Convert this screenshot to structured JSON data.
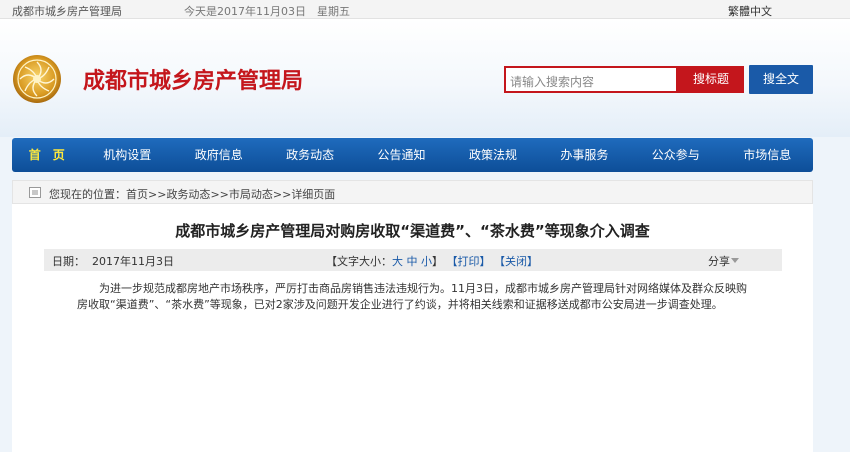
{
  "topbar": {
    "site_name": "成都市城乡房产管理局",
    "date_text": "今天是2017年11月03日　星期五",
    "lang_switch": "繁體中文"
  },
  "header": {
    "logo_text": "成都市城乡房产管理局",
    "search_placeholder": "请输入搜索内容",
    "search_title_button": "搜标题",
    "search_full_button": "搜全文"
  },
  "nav": {
    "items": [
      {
        "label": "首　页"
      },
      {
        "label": "机构设置"
      },
      {
        "label": "政府信息"
      },
      {
        "label": "政务动态"
      },
      {
        "label": "公告通知"
      },
      {
        "label": "政策法规"
      },
      {
        "label": "办事服务"
      },
      {
        "label": "公众参与"
      },
      {
        "label": "市场信息"
      }
    ]
  },
  "breadcrumb": {
    "prefix": "您现在的位置：",
    "items": [
      "首页",
      "政务动态",
      "市局动态",
      "详细页面"
    ],
    "separator": ">>"
  },
  "article": {
    "title": "成都市城乡房产管理局对购房收取“渠道费”、“茶水费”等现象介入调查",
    "date_label": "日期：",
    "date_value": "2017年11月3日",
    "font_size_label": "【文字大小：",
    "font_large": "大",
    "font_medium": "中",
    "font_small": "小",
    "font_close": "】",
    "print_label": "【打印】",
    "close_label": "【关闭】",
    "share_label": "分享",
    "body": "为进一步规范成都房地产市场秩序，严厉打击商品房销售违法违规行为。11月3日，成都市城乡房产管理局针对网络媒体及群众反映购房收取“渠道费”、“茶水费”等现象，已对2家涉及问题开发企业进行了约谈，并将相关线索和证据移送成都市公安局进一步调查处理。"
  },
  "colors": {
    "brand_red": "#c4161c",
    "nav_blue": "#1a5aa8",
    "nav_active": "#ffe93b"
  }
}
